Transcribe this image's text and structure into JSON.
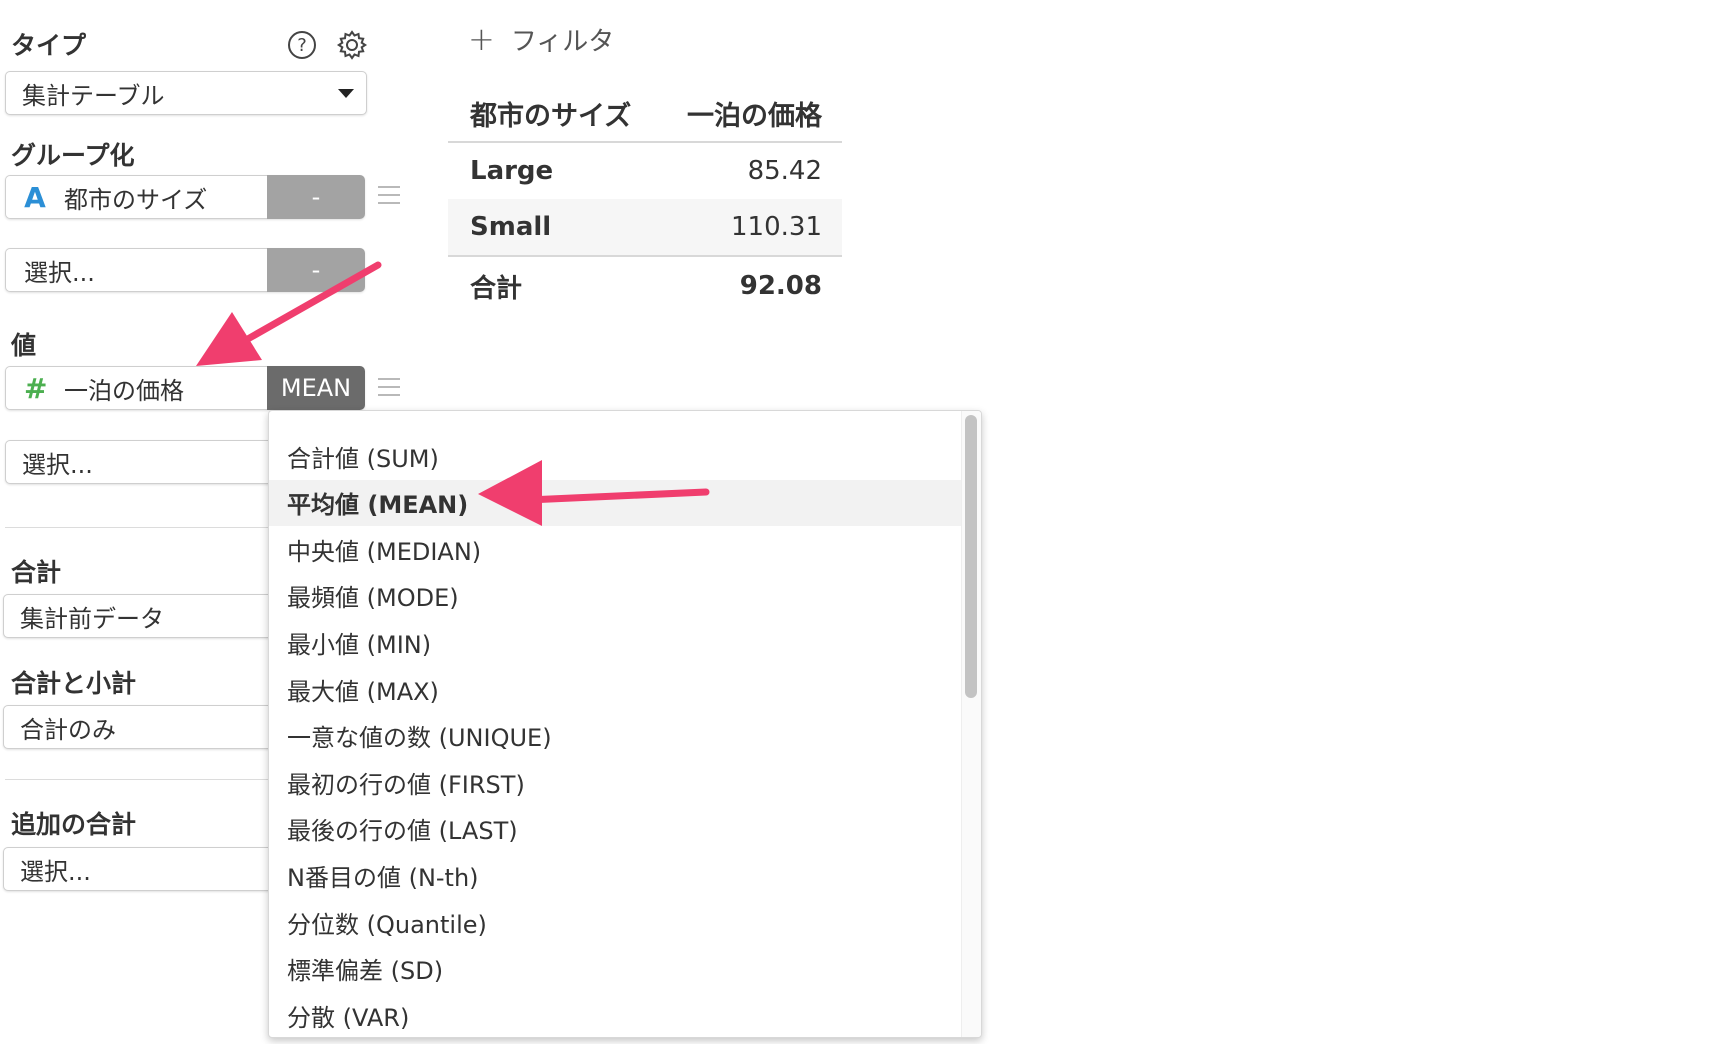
{
  "colors": {
    "accent_arrow": "#f03e6e",
    "string_type": "#2b8fd6",
    "number_type": "#4caf50",
    "dash_button": "#a3a3a3",
    "aggregate_button": "#6b6b6b"
  },
  "sidebar": {
    "type_label": "タイプ",
    "help_icon": "question-circle-icon",
    "settings_icon": "gear-icon",
    "type_value": "集計テーブル",
    "group_label": "グループ化",
    "group_items": [
      {
        "type_icon": "A",
        "field": "都市のサイズ",
        "button": "-"
      },
      {
        "field": "選択...",
        "button": "-"
      }
    ],
    "value_label": "値",
    "value_items": [
      {
        "type_icon": "#",
        "field": "一泊の価格",
        "button": "MEAN"
      },
      {
        "field": "選択..."
      }
    ],
    "total_label": "合計",
    "total_value": "集計前データ",
    "subtotal_label": "合計と小計",
    "subtotal_value": "合計のみ",
    "extra_total_label": "追加の合計",
    "extra_total_value": "選択..."
  },
  "filter": {
    "icon": "+",
    "label": "フィルタ"
  },
  "table": {
    "headers": [
      "都市のサイズ",
      "一泊の価格"
    ],
    "rows": [
      {
        "name": "Large",
        "value": "85.42"
      },
      {
        "name": "Small",
        "value": "110.31"
      }
    ],
    "total": {
      "name": "合計",
      "value": "92.08"
    }
  },
  "dropdown": {
    "selected_index": 1,
    "items": [
      "合計値 (SUM)",
      "平均値 (MEAN)",
      "中央値 (MEDIAN)",
      "最頻値 (MODE)",
      "最小値 (MIN)",
      "最大値 (MAX)",
      "一意な値の数 (UNIQUE)",
      "最初の行の値 (FIRST)",
      "最後の行の値 (LAST)",
      "N番目の値 (N-th)",
      "分位数 (Quantile)",
      "標準偏差 (SD)",
      "分散 (VAR)"
    ]
  }
}
